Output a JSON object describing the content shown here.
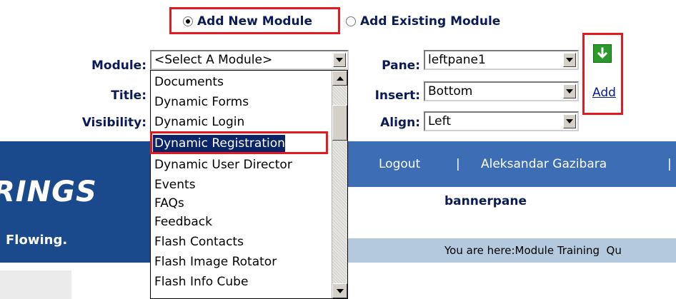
{
  "module_mode": {
    "add_new_label": "Add New Module",
    "add_existing_label": "Add Existing Module",
    "selected": "add_new"
  },
  "form": {
    "module_label": "Module:",
    "module_value": "<Select A Module>",
    "title_label": "Title:",
    "visibility_label": "Visibility:",
    "pane_label": "Pane:",
    "pane_value": "leftpane1",
    "insert_label": "Insert:",
    "insert_value": "Bottom",
    "align_label": "Align:",
    "align_value": "Left",
    "add_link": "Add",
    "add_icon": "green-down-arrow-icon"
  },
  "module_dropdown": {
    "options": [
      "Documents",
      "Dynamic Forms",
      "Dynamic Login",
      "Dynamic Registration",
      "Dynamic User Director",
      "Events",
      "FAQs",
      "Feedback",
      "Flash Contacts",
      "Flash Image Rotator",
      "Flash Info Cube"
    ],
    "highlighted": "Dynamic Registration"
  },
  "banner": {
    "logo_partial_text": "RINGS",
    "tagline_partial": "Flowing.",
    "logout_label": "Logout",
    "separator": "|",
    "user_name": "Aleksandar Gazibara",
    "bannerpane_label": "bannerpane",
    "breadcrumb_text": "You are here:Module Training  Qu"
  },
  "colors": {
    "highlight_border": "#e2191f",
    "label_navy": "#0b1b55",
    "banner_dark": "#1a4a8c",
    "banner_nav": "#3d6db4",
    "banner_light": "#b4c8de",
    "selection_bg": "#0a246a"
  }
}
